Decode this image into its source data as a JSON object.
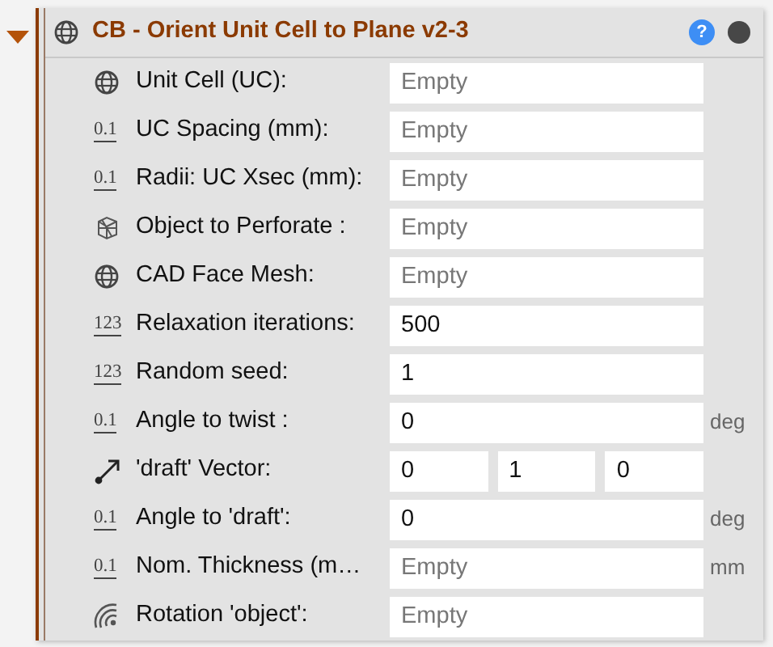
{
  "panel": {
    "title": "CB - Orient Unit Cell to Plane v2-3",
    "expanded": true,
    "help": "?"
  },
  "rows": [
    {
      "kind": "globe",
      "label": "Unit Cell (UC):",
      "fields": [
        {
          "placeholder": "Empty"
        }
      ]
    },
    {
      "kind": "number",
      "icon_text": "0.1",
      "label": "UC Spacing (mm):",
      "fields": [
        {
          "placeholder": "Empty"
        }
      ]
    },
    {
      "kind": "number",
      "icon_text": "0.1",
      "label": "Radii: UC Xsec (mm):",
      "fields": [
        {
          "placeholder": "Empty"
        }
      ]
    },
    {
      "kind": "mesh",
      "label": "Object to Perforate  :",
      "fields": [
        {
          "placeholder": "Empty"
        }
      ]
    },
    {
      "kind": "globe",
      "label": "CAD Face Mesh:",
      "fields": [
        {
          "placeholder": "Empty"
        }
      ]
    },
    {
      "kind": "number",
      "icon_text": "123",
      "label": "Relaxation iterations:",
      "fields": [
        {
          "value": "500"
        }
      ]
    },
    {
      "kind": "number",
      "icon_text": "123",
      "label": "Random seed:",
      "fields": [
        {
          "value": "1"
        }
      ]
    },
    {
      "kind": "number",
      "icon_text": "0.1",
      "label": "Angle to twist :",
      "fields": [
        {
          "value": "0"
        }
      ],
      "unit": "deg"
    },
    {
      "kind": "vector",
      "label": "'draft' Vector:",
      "fields": [
        {
          "value": "0"
        },
        {
          "value": "1"
        },
        {
          "value": "0"
        }
      ]
    },
    {
      "kind": "number",
      "icon_text": "0.1",
      "label": "Angle to 'draft':",
      "fields": [
        {
          "value": "0"
        }
      ],
      "unit": "deg"
    },
    {
      "kind": "number",
      "icon_text": "0.1",
      "label": "Nom. Thickness (m…",
      "fields": [
        {
          "placeholder": "Empty"
        }
      ],
      "unit": "mm"
    },
    {
      "kind": "rotation",
      "label": "Rotation 'object':",
      "fields": [
        {
          "placeholder": "Empty"
        }
      ]
    }
  ]
}
